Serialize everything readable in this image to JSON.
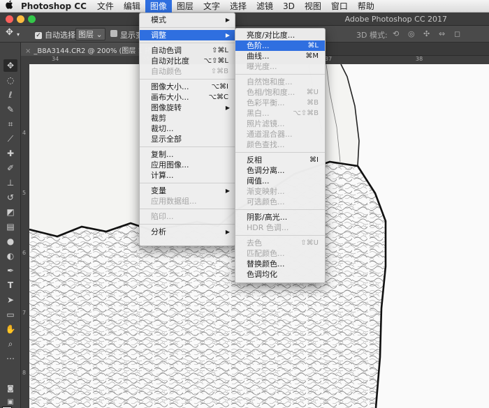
{
  "menubar": {
    "apple": "",
    "app": "Photoshop CC",
    "items": [
      "文件",
      "编辑",
      "图像",
      "图层",
      "文字",
      "选择",
      "滤镜",
      "3D",
      "视图",
      "窗口",
      "帮助"
    ],
    "active_index": 2
  },
  "titlebar": {
    "title": "Adobe Photoshop CC 2017"
  },
  "options": {
    "auto_select_label": "自动选择:",
    "auto_select_target": "图层",
    "show_transform": "显示变",
    "mode_3d": "3D 模式:"
  },
  "doc_tab": {
    "title": "_B8A3144.CR2 @ 200% (图层 1 拷"
  },
  "ruler": {
    "top_ticks": [
      "34",
      "35",
      "36",
      "37",
      "38"
    ],
    "left_ticks": [
      "4",
      "5",
      "6",
      "7",
      "8",
      "9"
    ]
  },
  "image_menu": {
    "items": [
      {
        "label": "模式",
        "arrow": true
      },
      {
        "sep": true
      },
      {
        "label": "调整",
        "arrow": true,
        "highlight": true
      },
      {
        "sep": true
      },
      {
        "label": "自动色调",
        "shortcut": "⇧⌘L"
      },
      {
        "label": "自动对比度",
        "shortcut": "⌥⇧⌘L"
      },
      {
        "label": "自动颜色",
        "shortcut": "⇧⌘B",
        "disabled": true
      },
      {
        "sep": true
      },
      {
        "label": "图像大小...",
        "shortcut": "⌥⌘I"
      },
      {
        "label": "画布大小...",
        "shortcut": "⌥⌘C"
      },
      {
        "label": "图像旋转",
        "arrow": true
      },
      {
        "label": "裁剪"
      },
      {
        "label": "裁切..."
      },
      {
        "label": "显示全部"
      },
      {
        "sep": true
      },
      {
        "label": "复制..."
      },
      {
        "label": "应用图像..."
      },
      {
        "label": "计算..."
      },
      {
        "sep": true
      },
      {
        "label": "变量",
        "arrow": true
      },
      {
        "label": "应用数据组...",
        "disabled": true
      },
      {
        "sep": true
      },
      {
        "label": "陷印...",
        "disabled": true
      },
      {
        "sep": true
      },
      {
        "label": "分析",
        "arrow": true
      }
    ]
  },
  "adjust_menu": {
    "items": [
      {
        "label": "亮度/对比度..."
      },
      {
        "label": "色阶...",
        "shortcut": "⌘L",
        "highlight": true
      },
      {
        "label": "曲线...",
        "shortcut": "⌘M"
      },
      {
        "label": "曝光度...",
        "disabled": true
      },
      {
        "sep": true
      },
      {
        "label": "自然饱和度...",
        "disabled": true
      },
      {
        "label": "色相/饱和度...",
        "shortcut": "⌘U",
        "disabled": true
      },
      {
        "label": "色彩平衡...",
        "shortcut": "⌘B",
        "disabled": true
      },
      {
        "label": "黑白...",
        "shortcut": "⌥⇧⌘B",
        "disabled": true
      },
      {
        "label": "照片滤镜...",
        "disabled": true
      },
      {
        "label": "通道混合器...",
        "disabled": true
      },
      {
        "label": "颜色查找...",
        "disabled": true
      },
      {
        "sep": true
      },
      {
        "label": "反相",
        "shortcut": "⌘I"
      },
      {
        "label": "色调分离..."
      },
      {
        "label": "阈值..."
      },
      {
        "label": "渐变映射...",
        "disabled": true
      },
      {
        "label": "可选颜色...",
        "disabled": true
      },
      {
        "sep": true
      },
      {
        "label": "阴影/高光..."
      },
      {
        "label": "HDR 色调...",
        "disabled": true
      },
      {
        "sep": true
      },
      {
        "label": "去色",
        "shortcut": "⇧⌘U",
        "disabled": true
      },
      {
        "label": "匹配颜色...",
        "disabled": true
      },
      {
        "label": "替换颜色..."
      },
      {
        "label": "色调均化"
      }
    ]
  },
  "colors": {
    "highlight": "#2f6fe0",
    "close": "#fc605c",
    "min": "#fdbc40",
    "max": "#34c84a"
  }
}
